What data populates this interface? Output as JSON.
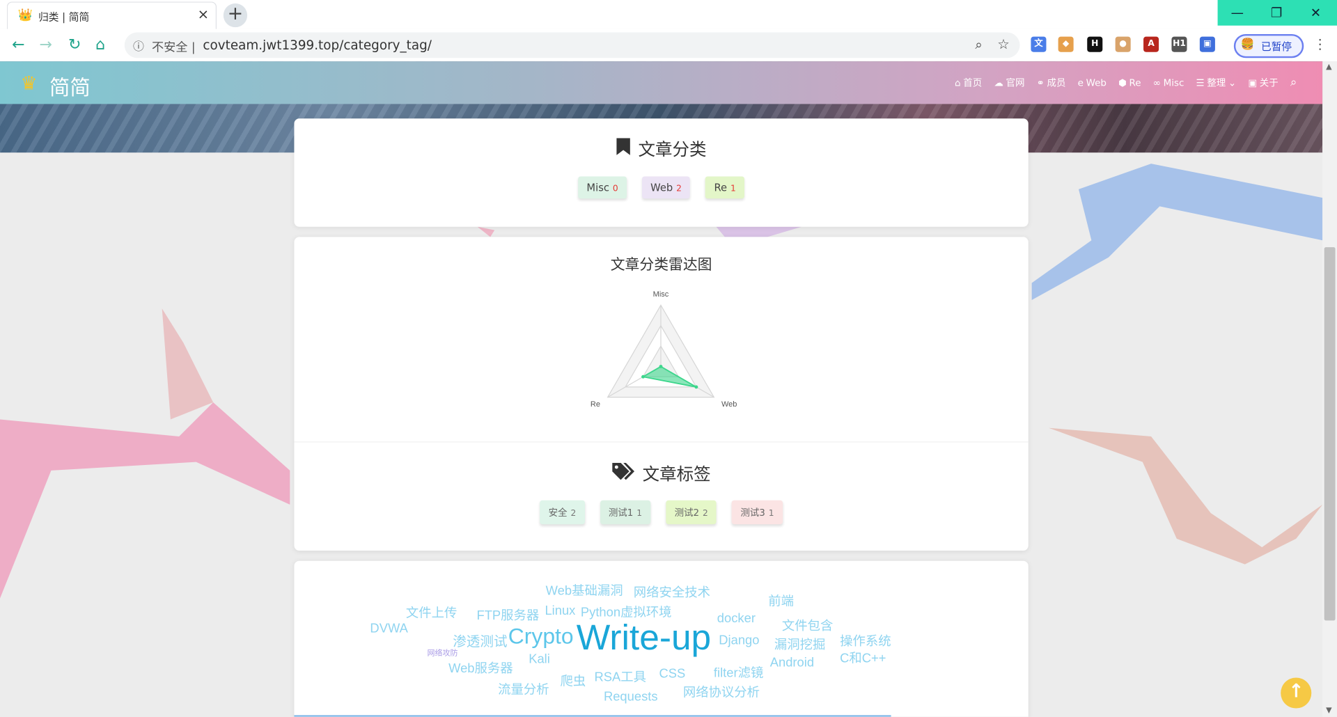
{
  "browser": {
    "tab_title": "归类 | 简简",
    "tab_close": "×",
    "new_tab": "+",
    "insecure_label": "不安全 |",
    "url": "covteam.jwt1399.top/category_tag/",
    "paused_label": "已暂停",
    "window_controls": [
      "—",
      "❐",
      "✕"
    ]
  },
  "site": {
    "logo": "简简",
    "menu": [
      {
        "icon": "home-icon",
        "label": "首页"
      },
      {
        "icon": "site-icon",
        "label": "官网"
      },
      {
        "icon": "members-icon",
        "label": "成员"
      },
      {
        "icon": "web-icon",
        "label": "Web"
      },
      {
        "icon": "re-icon",
        "label": "Re"
      },
      {
        "icon": "misc-icon",
        "label": "Misc"
      },
      {
        "icon": "list-icon",
        "label": "整理"
      },
      {
        "icon": "about-icon",
        "label": "关于"
      }
    ]
  },
  "categories": {
    "title": "文章分类",
    "items": [
      {
        "name": "Misc",
        "count": "0",
        "bg": "#ddf3e6"
      },
      {
        "name": "Web",
        "count": "2",
        "bg": "#ece4f5"
      },
      {
        "name": "Re",
        "count": "1",
        "bg": "#e3f6c8"
      }
    ]
  },
  "radar": {
    "title": "文章分类雷达图",
    "axes": [
      "Misc",
      "Web",
      "Re"
    ],
    "max": 3
  },
  "chart_data": {
    "type": "radar",
    "title": "文章分类雷达图",
    "categories": [
      "Misc",
      "Web",
      "Re"
    ],
    "values": [
      0,
      2,
      1
    ],
    "fill_color": "#3dd68c"
  },
  "tags": {
    "title": "文章标签",
    "items": [
      {
        "name": "安全",
        "count": "2",
        "bg": "#dff5ea"
      },
      {
        "name": "测试1",
        "count": "1",
        "bg": "#dcf1e4"
      },
      {
        "name": "测试2",
        "count": "2",
        "bg": "#e5f7c8"
      },
      {
        "name": "测试3",
        "count": "1",
        "bg": "#fbe4e4"
      }
    ]
  },
  "word_cloud": [
    {
      "text": "Web基础漏洞",
      "size": 15
    },
    {
      "text": "网络安全技术",
      "size": 15
    },
    {
      "text": "前端",
      "size": 15
    },
    {
      "text": "文件上传",
      "size": 15
    },
    {
      "text": "FTP服务器",
      "size": 15
    },
    {
      "text": "Linux",
      "size": 15
    },
    {
      "text": "Python虚拟环境",
      "size": 15
    },
    {
      "text": "docker",
      "size": 15
    },
    {
      "text": "文件包含",
      "size": 15
    },
    {
      "text": "DVWA",
      "size": 15
    },
    {
      "text": "渗透测试",
      "size": 16
    },
    {
      "text": "Crypto",
      "size": 26
    },
    {
      "text": "Write-up",
      "size": 42
    },
    {
      "text": "Django",
      "size": 15
    },
    {
      "text": "漏洞挖掘",
      "size": 15
    },
    {
      "text": "操作系统",
      "size": 15
    },
    {
      "text": "网络攻防",
      "size": 9
    },
    {
      "text": "Kali",
      "size": 15
    },
    {
      "text": "C和C++",
      "size": 15
    },
    {
      "text": "Web服务器",
      "size": 15
    },
    {
      "text": "Android",
      "size": 15
    },
    {
      "text": "filter滤镜",
      "size": 15
    },
    {
      "text": "爬虫",
      "size": 15
    },
    {
      "text": "RSA工具",
      "size": 15
    },
    {
      "text": "CSS",
      "size": 15
    },
    {
      "text": "流量分析",
      "size": 15
    },
    {
      "text": "网络协议分析",
      "size": 15
    },
    {
      "text": "Requests",
      "size": 15
    }
  ],
  "colors": {
    "accent": "#1aa6d8",
    "word": "#8fd4f0",
    "word_alt": "#a99be6",
    "nav_start": "#7fc7d1",
    "nav_end": "#ef8db3"
  }
}
